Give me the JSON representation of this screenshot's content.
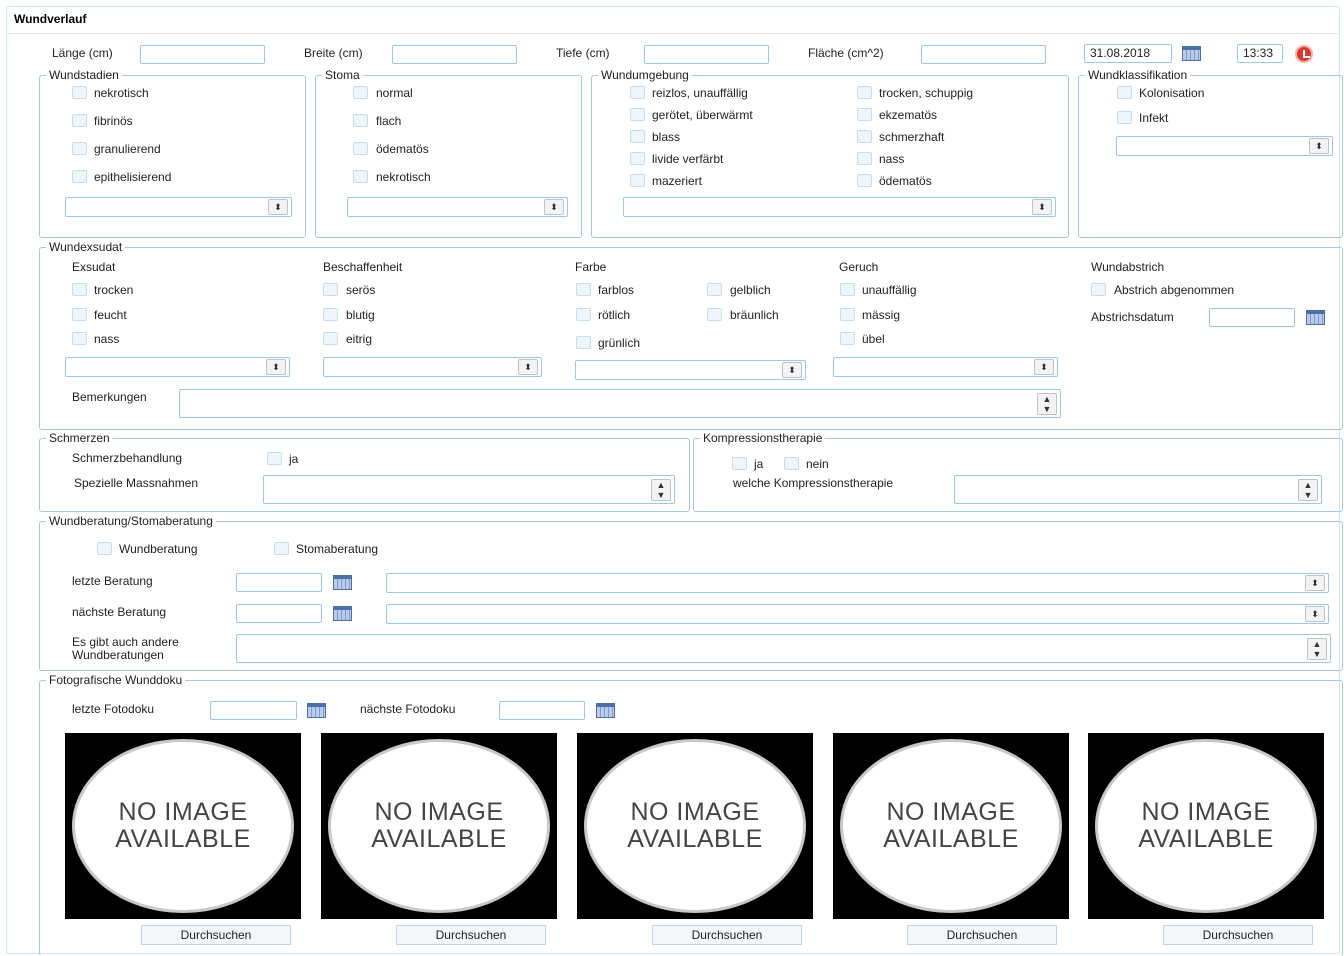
{
  "title": "Wundverlauf",
  "measures": {
    "laenge": "Länge (cm)",
    "breite": "Breite (cm)",
    "tiefe": "Tiefe (cm)",
    "flaeche": "Fläche (cm^2)",
    "date": "31.08.2018",
    "time": "13:33"
  },
  "wundstadien": {
    "title": "Wundstadien",
    "items": [
      "nekrotisch",
      "fibrinös",
      "granulierend",
      "epithelisierend"
    ]
  },
  "stoma": {
    "title": "Stoma",
    "items": [
      "normal",
      "flach",
      "ödematös",
      "nekrotisch"
    ]
  },
  "wundumgebung": {
    "title": "Wundumgebung",
    "left": [
      "reizlos, unauffällig",
      "gerötet, überwärmt",
      "blass",
      "livide verfärbt",
      "mazeriert"
    ],
    "right": [
      "trocken, schuppig",
      "ekzematös",
      "schmerzhaft",
      "nass",
      "ödematös"
    ]
  },
  "wundklassifikation": {
    "title": "Wundklassifikation",
    "items": [
      "Kolonisation",
      "Infekt"
    ]
  },
  "wundexsudat": {
    "title": "Wundexsudat",
    "exsudat": {
      "label": "Exsudat",
      "items": [
        "trocken",
        "feucht",
        "nass"
      ]
    },
    "beschaffenheit": {
      "label": "Beschaffenheit",
      "items": [
        "serös",
        "blutig",
        "eitrig"
      ]
    },
    "farbe": {
      "label": "Farbe",
      "left": [
        "farblos",
        "rötlich",
        "grünlich"
      ],
      "right": [
        "gelblich",
        "bräunlich"
      ]
    },
    "geruch": {
      "label": "Geruch",
      "items": [
        "unauffällig",
        "mässig",
        "übel"
      ]
    },
    "wundabstrich": {
      "label": "Wundabstrich",
      "abgenommen": "Abstrich abgenommen",
      "datum": "Abstrichsdatum"
    },
    "bemerkungen": "Bemerkungen"
  },
  "schmerzen": {
    "title": "Schmerzen",
    "behandlung": "Schmerzbehandlung",
    "ja": "ja",
    "massnahmen": "Spezielle Massnahmen"
  },
  "kompression": {
    "title": "Kompressionstherapie",
    "ja": "ja",
    "nein": "nein",
    "welche": "welche Kompressionstherapie"
  },
  "beratung": {
    "title": "Wundberatung/Stomaberatung",
    "wund": "Wundberatung",
    "stoma": "Stomaberatung",
    "letzte": "letzte Beratung",
    "naechste": "nächste Beratung",
    "andere1": "Es gibt auch andere",
    "andere2": "Wundberatungen"
  },
  "foto": {
    "title": "Fotografische Wunddoku",
    "letzte": "letzte Fotodoku",
    "naechste": "nächste Fotodoku",
    "noimage1": "NO IMAGE",
    "noimage2": "AVAILABLE",
    "browse": "Durchsuchen"
  }
}
